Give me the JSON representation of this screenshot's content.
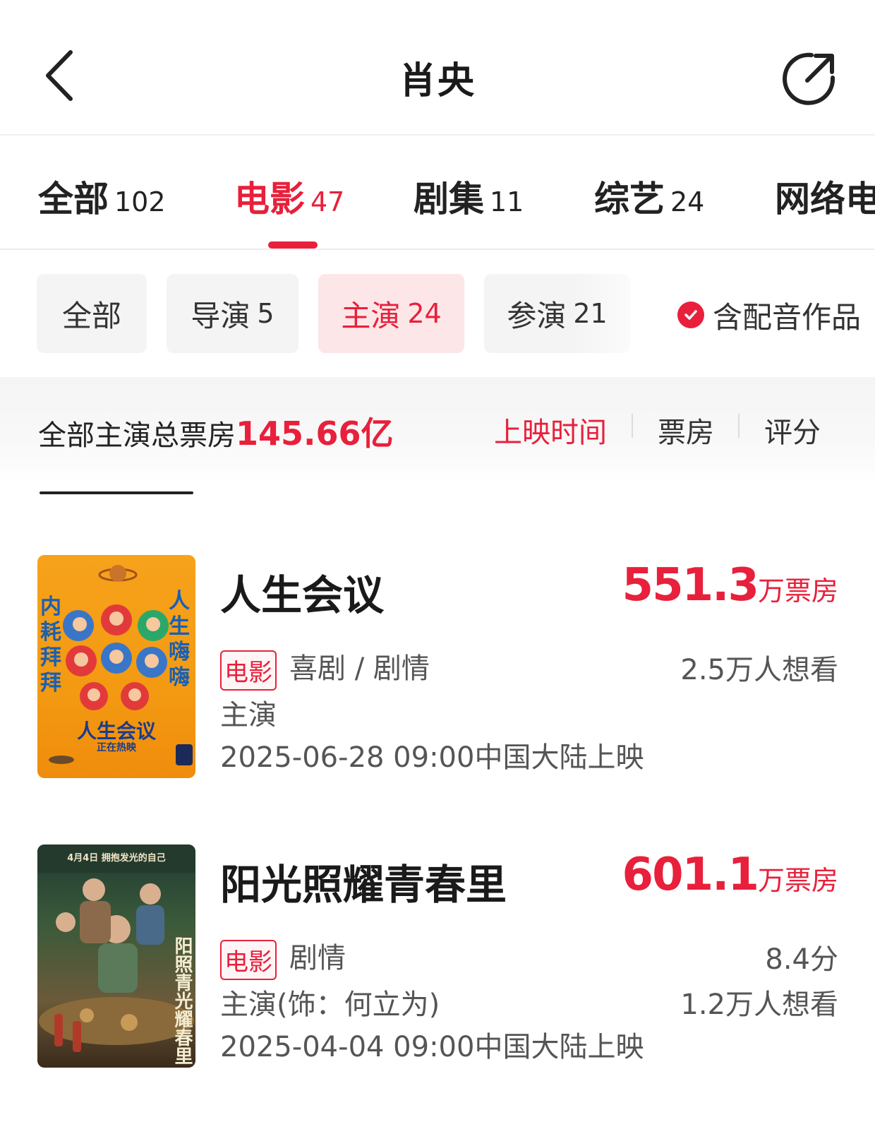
{
  "header": {
    "title": "肖央"
  },
  "tabs": [
    {
      "label": "全部",
      "count": "102"
    },
    {
      "label": "电影",
      "count": "47"
    },
    {
      "label": "剧集",
      "count": "11"
    },
    {
      "label": "综艺",
      "count": "24"
    },
    {
      "label": "网络电",
      "count": ""
    }
  ],
  "filters": {
    "chips": [
      {
        "label": "全部",
        "count": ""
      },
      {
        "label": "导演",
        "count": "5"
      },
      {
        "label": "主演",
        "count": "24"
      },
      {
        "label": "参演",
        "count": "21"
      }
    ],
    "dubbing_toggle": "含配音作品"
  },
  "summary": {
    "label": "全部主演总票房",
    "value": "145.66亿",
    "sort_options": [
      "上映时间",
      "票房",
      "评分"
    ]
  },
  "movies": [
    {
      "title": "人生会议",
      "box_office": "551.3",
      "box_office_unit": "万票房",
      "type_badge": "电影",
      "genres": "喜剧 / 剧情",
      "role": "主演",
      "release": "2025-06-28 09:00中国大陆上映",
      "score": "",
      "want_to_see": "2.5万人想看",
      "poster": {
        "left_text": "内耗拜拜",
        "right_text": "人生嗨嗨",
        "title": "人生会议",
        "subtitle": "正在热映"
      }
    },
    {
      "title": "阳光照耀青春里",
      "box_office": "601.1",
      "box_office_unit": "万票房",
      "type_badge": "电影",
      "genres": "剧情",
      "role": "主演(饰：何立为)",
      "release": "2025-04-04 09:00中国大陆上映",
      "score": "8.4分",
      "want_to_see": "1.2万人想看",
      "poster": {
        "top_text": "4月4日  拥抱发光的自己",
        "title": "阳照青光耀春里"
      }
    }
  ],
  "colors": {
    "accent": "#e8203b",
    "chip_bg": "#f4f4f4",
    "chip_active_bg": "#fde6e8"
  }
}
